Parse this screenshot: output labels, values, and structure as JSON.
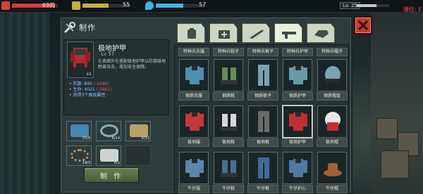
{
  "hud": {
    "health_value": "69",
    "health_suffix": "的",
    "hunger_value": "55",
    "water_value": "57",
    "level_label": "Lv. 25",
    "alert_text": "爆伍: E",
    "health_color": "#d9403a",
    "hunger_color": "#c8b040",
    "water_color": "#3fb4e8",
    "health_fill": 0.92,
    "hunger_fill": 0.55,
    "water_fill": 0.55,
    "level_fill": 0.6
  },
  "panel": {
    "title": "制作",
    "icon": "wrench-screwdriver-icon"
  },
  "selected_item": {
    "name": "极地护甲",
    "level": "Lv 57",
    "portrait_count": "x1",
    "description": "在表面外在搭配极地护甲以防御极地野兽攻击，增加安全保障。",
    "stats": [
      {
        "label": "防御: 895",
        "delta": "(-1046)"
      },
      {
        "label": "生命: 4021",
        "delta": "(-3461)"
      }
    ],
    "extra": "• 获得3个高级属性"
  },
  "materials": [
    {
      "qty": "25/9",
      "color": "#4a82b0",
      "icon": "cloth-icon"
    },
    {
      "qty": "6/14",
      "color": "#8fa9b8",
      "icon": "wire-icon"
    },
    {
      "qty": "6/33",
      "color": "#b8a068",
      "icon": "leather-icon"
    },
    {
      "qty": "14/3",
      "color": "#c08850",
      "icon": "rope-icon"
    },
    {
      "qty": "6/1",
      "color": "#cfd3d0",
      "icon": "fabric-icon"
    },
    {
      "qty": "",
      "color": "",
      "icon": "empty-slot-icon"
    }
  ],
  "craft_label": "制 作",
  "tabs": [
    {
      "icon": "backpack-tab-icon"
    },
    {
      "icon": "medkit-tab-icon"
    },
    {
      "icon": "blade-tab-icon"
    },
    {
      "icon": "gun-tab-icon"
    },
    {
      "icon": "armor-tab-icon"
    }
  ],
  "top_row": [
    "特种兵衣服",
    "特种兵鞋子",
    "特种兵裤子",
    "特种兵护甲",
    "特种兵帽子"
  ],
  "rows": [
    [
      {
        "name": "钢质衣服",
        "icon": "steel-shirt-icon",
        "color": "#4f8fae"
      },
      {
        "name": "钢质靴",
        "icon": "steel-boots-icon",
        "color": "#6a8a5a"
      },
      {
        "name": "钢质裤子",
        "icon": "steel-pants-icon",
        "color": "#7aa0b6"
      },
      {
        "name": "钢质护甲",
        "icon": "steel-armor-icon",
        "color": "#6a9aa8"
      },
      {
        "name": "钢质帽盔",
        "icon": "steel-helmet-icon",
        "color": "#7aa2b0"
      }
    ],
    [
      {
        "name": "极地服",
        "icon": "polar-suit-icon",
        "color": "#c23a3a"
      },
      {
        "name": "极地靴",
        "icon": "polar-boots-icon",
        "color": "#d8d8d8"
      },
      {
        "name": "极地裤",
        "icon": "polar-pants-icon",
        "color": "#6b6b6b"
      },
      {
        "name": "极地护甲",
        "icon": "polar-armor-icon",
        "color": "#c03030"
      },
      {
        "name": "极地帽",
        "icon": "polar-hat-icon",
        "color": "#e8e8e8"
      }
    ],
    [
      {
        "name": "牛仔服",
        "icon": "denim-jacket-icon",
        "color": "#5b86b2"
      },
      {
        "name": "牛仔鞋",
        "icon": "denim-shoes-icon",
        "color": "#4a6e8e"
      },
      {
        "name": "牛仔裤",
        "icon": "jeans-icon",
        "color": "#3f6b9a"
      },
      {
        "name": "牛仔护心",
        "icon": "denim-vest-icon",
        "color": "#4e7aa0"
      },
      {
        "name": "牛仔帽",
        "icon": "cowboy-hat-icon",
        "color": "#a0603a"
      }
    ]
  ],
  "selected_cell": {
    "row": 1,
    "col": 3
  }
}
